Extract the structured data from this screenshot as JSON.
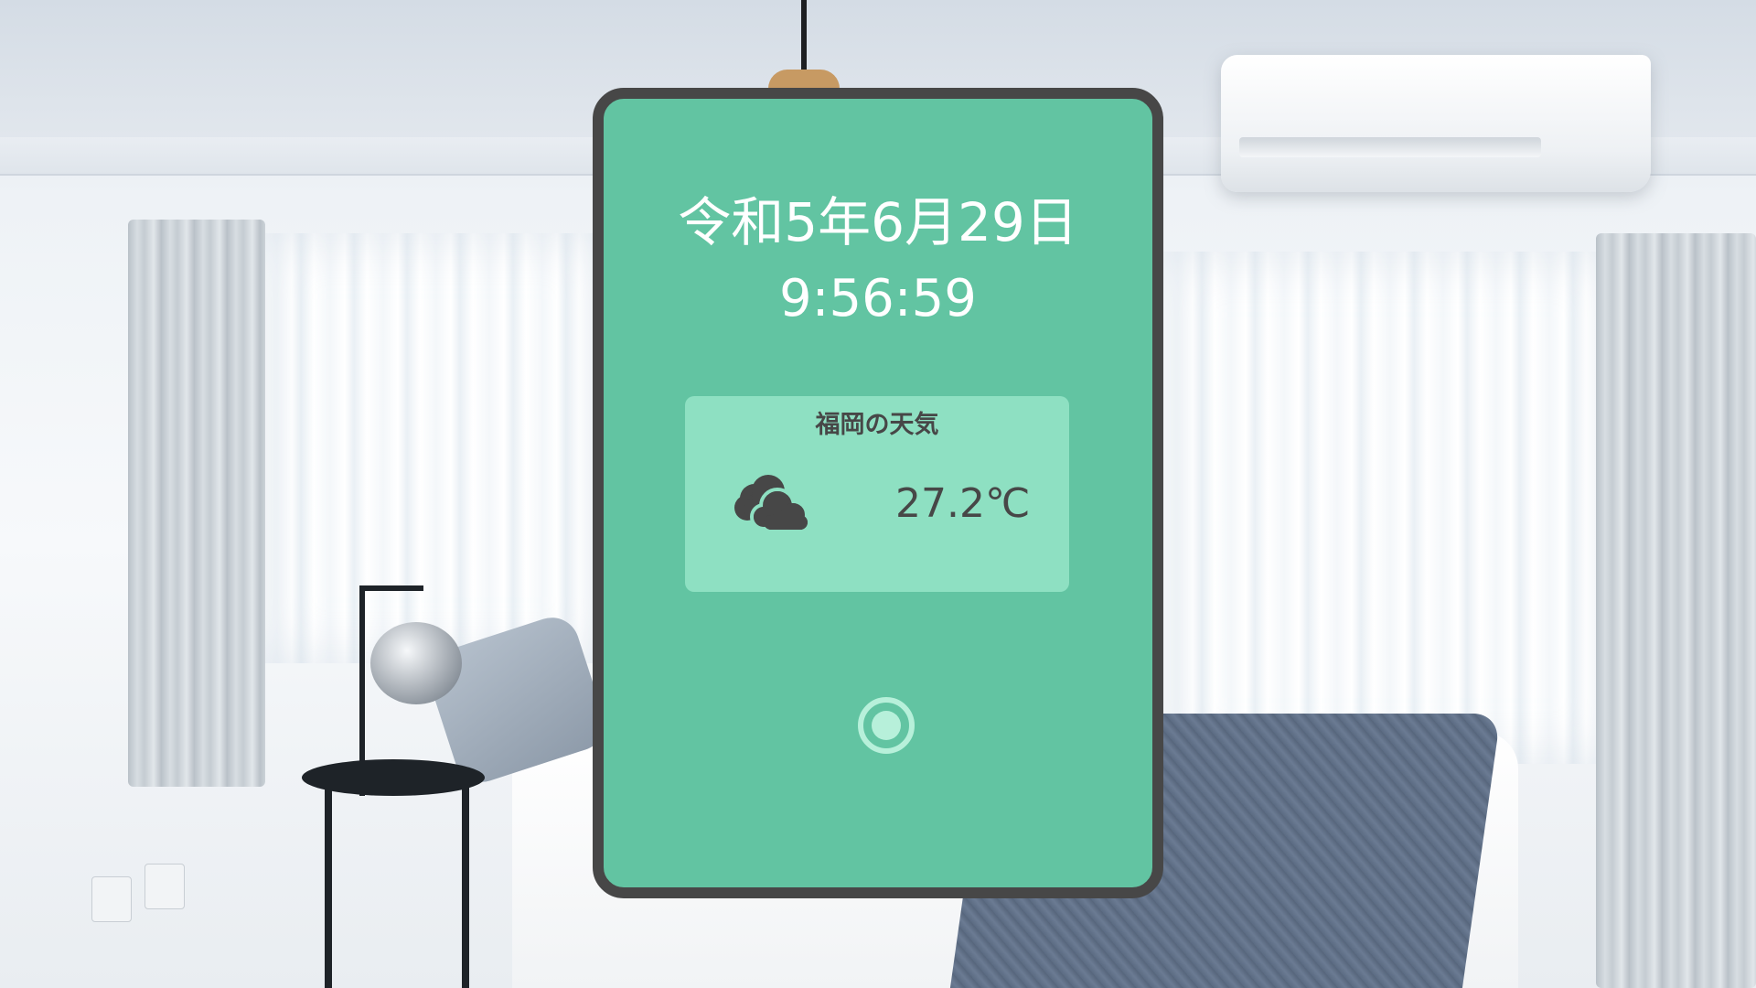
{
  "background": {
    "icon": "bedroom-photo"
  },
  "widget": {
    "colors": {
      "panel": "#62c4a2",
      "frame": "#474747",
      "card": "#8ee0c2",
      "text_light": "#ffffff",
      "text_dark": "#474747",
      "button": "#b7f0da"
    },
    "date": "令和5年6月29日",
    "time": "9:56:59",
    "weather": {
      "title": "福岡の天気",
      "icon": "cloud-icon",
      "temperature": "27.2℃"
    },
    "button": {
      "icon": "record-icon"
    }
  }
}
